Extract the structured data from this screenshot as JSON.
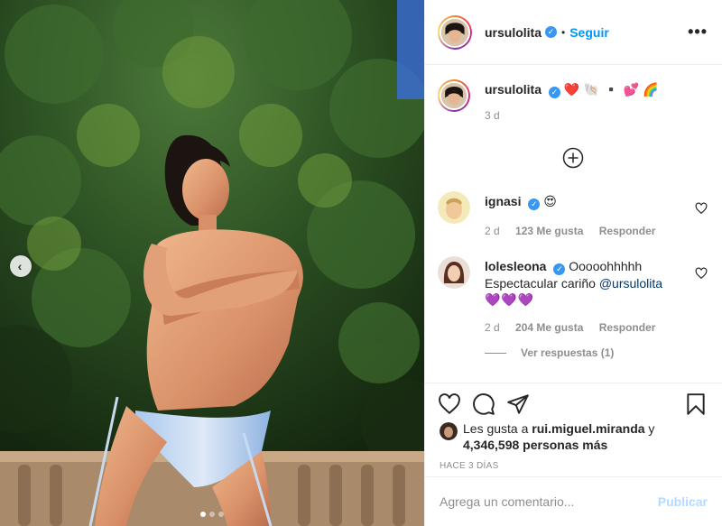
{
  "post": {
    "author": "ursulolita",
    "follow_label": "Seguir",
    "more_label": "•••",
    "verified_mark": "✓",
    "separator": "•"
  },
  "caption": {
    "username": "ursulolita",
    "text": "❤️ 🐚 ▪️ 💕 🌈",
    "time": "3 d"
  },
  "comments": [
    {
      "username": "ignasi",
      "text": "😍",
      "time": "2 d",
      "likes": "123 Me gusta",
      "reply_label": "Responder"
    },
    {
      "username": "lolesleona",
      "text": "Ooooohhhhh Espectacular cariño",
      "mention": "@ursulolita",
      "hearts": "💜💜💜",
      "time": "2 d",
      "likes": "204 Me gusta",
      "reply_label": "Responder"
    }
  ],
  "view_replies": "Ver respuestas (1)",
  "likes_summary": {
    "prefix": "Les gusta a",
    "user": "rui.miguel.miranda",
    "joiner": "y",
    "others": "4,346,598 personas más"
  },
  "timestamp": "HACE 3 DÍAS",
  "comment_box": {
    "placeholder": "Agrega un comentario...",
    "publish_label": "Publicar"
  },
  "carousel": {
    "prev_label": "‹",
    "slide_count": 3,
    "active_index": 0
  },
  "colors": {
    "accent": "#0095f6",
    "verified": "#3897f0",
    "publish_disabled": "#b3dbff",
    "muted": "#8e8e8e"
  }
}
